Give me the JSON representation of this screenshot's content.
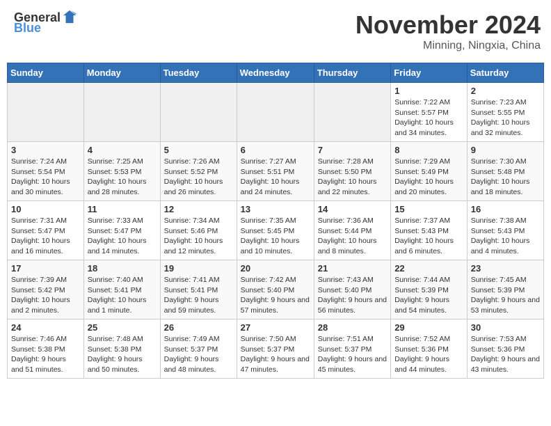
{
  "header": {
    "logo_general": "General",
    "logo_blue": "Blue",
    "month": "November 2024",
    "location": "Minning, Ningxia, China"
  },
  "days_of_week": [
    "Sunday",
    "Monday",
    "Tuesday",
    "Wednesday",
    "Thursday",
    "Friday",
    "Saturday"
  ],
  "weeks": [
    [
      {
        "day": "",
        "info": ""
      },
      {
        "day": "",
        "info": ""
      },
      {
        "day": "",
        "info": ""
      },
      {
        "day": "",
        "info": ""
      },
      {
        "day": "",
        "info": ""
      },
      {
        "day": "1",
        "info": "Sunrise: 7:22 AM\nSunset: 5:57 PM\nDaylight: 10 hours and 34 minutes."
      },
      {
        "day": "2",
        "info": "Sunrise: 7:23 AM\nSunset: 5:55 PM\nDaylight: 10 hours and 32 minutes."
      }
    ],
    [
      {
        "day": "3",
        "info": "Sunrise: 7:24 AM\nSunset: 5:54 PM\nDaylight: 10 hours and 30 minutes."
      },
      {
        "day": "4",
        "info": "Sunrise: 7:25 AM\nSunset: 5:53 PM\nDaylight: 10 hours and 28 minutes."
      },
      {
        "day": "5",
        "info": "Sunrise: 7:26 AM\nSunset: 5:52 PM\nDaylight: 10 hours and 26 minutes."
      },
      {
        "day": "6",
        "info": "Sunrise: 7:27 AM\nSunset: 5:51 PM\nDaylight: 10 hours and 24 minutes."
      },
      {
        "day": "7",
        "info": "Sunrise: 7:28 AM\nSunset: 5:50 PM\nDaylight: 10 hours and 22 minutes."
      },
      {
        "day": "8",
        "info": "Sunrise: 7:29 AM\nSunset: 5:49 PM\nDaylight: 10 hours and 20 minutes."
      },
      {
        "day": "9",
        "info": "Sunrise: 7:30 AM\nSunset: 5:48 PM\nDaylight: 10 hours and 18 minutes."
      }
    ],
    [
      {
        "day": "10",
        "info": "Sunrise: 7:31 AM\nSunset: 5:47 PM\nDaylight: 10 hours and 16 minutes."
      },
      {
        "day": "11",
        "info": "Sunrise: 7:33 AM\nSunset: 5:47 PM\nDaylight: 10 hours and 14 minutes."
      },
      {
        "day": "12",
        "info": "Sunrise: 7:34 AM\nSunset: 5:46 PM\nDaylight: 10 hours and 12 minutes."
      },
      {
        "day": "13",
        "info": "Sunrise: 7:35 AM\nSunset: 5:45 PM\nDaylight: 10 hours and 10 minutes."
      },
      {
        "day": "14",
        "info": "Sunrise: 7:36 AM\nSunset: 5:44 PM\nDaylight: 10 hours and 8 minutes."
      },
      {
        "day": "15",
        "info": "Sunrise: 7:37 AM\nSunset: 5:43 PM\nDaylight: 10 hours and 6 minutes."
      },
      {
        "day": "16",
        "info": "Sunrise: 7:38 AM\nSunset: 5:43 PM\nDaylight: 10 hours and 4 minutes."
      }
    ],
    [
      {
        "day": "17",
        "info": "Sunrise: 7:39 AM\nSunset: 5:42 PM\nDaylight: 10 hours and 2 minutes."
      },
      {
        "day": "18",
        "info": "Sunrise: 7:40 AM\nSunset: 5:41 PM\nDaylight: 10 hours and 1 minute."
      },
      {
        "day": "19",
        "info": "Sunrise: 7:41 AM\nSunset: 5:41 PM\nDaylight: 9 hours and 59 minutes."
      },
      {
        "day": "20",
        "info": "Sunrise: 7:42 AM\nSunset: 5:40 PM\nDaylight: 9 hours and 57 minutes."
      },
      {
        "day": "21",
        "info": "Sunrise: 7:43 AM\nSunset: 5:40 PM\nDaylight: 9 hours and 56 minutes."
      },
      {
        "day": "22",
        "info": "Sunrise: 7:44 AM\nSunset: 5:39 PM\nDaylight: 9 hours and 54 minutes."
      },
      {
        "day": "23",
        "info": "Sunrise: 7:45 AM\nSunset: 5:39 PM\nDaylight: 9 hours and 53 minutes."
      }
    ],
    [
      {
        "day": "24",
        "info": "Sunrise: 7:46 AM\nSunset: 5:38 PM\nDaylight: 9 hours and 51 minutes."
      },
      {
        "day": "25",
        "info": "Sunrise: 7:48 AM\nSunset: 5:38 PM\nDaylight: 9 hours and 50 minutes."
      },
      {
        "day": "26",
        "info": "Sunrise: 7:49 AM\nSunset: 5:37 PM\nDaylight: 9 hours and 48 minutes."
      },
      {
        "day": "27",
        "info": "Sunrise: 7:50 AM\nSunset: 5:37 PM\nDaylight: 9 hours and 47 minutes."
      },
      {
        "day": "28",
        "info": "Sunrise: 7:51 AM\nSunset: 5:37 PM\nDaylight: 9 hours and 45 minutes."
      },
      {
        "day": "29",
        "info": "Sunrise: 7:52 AM\nSunset: 5:36 PM\nDaylight: 9 hours and 44 minutes."
      },
      {
        "day": "30",
        "info": "Sunrise: 7:53 AM\nSunset: 5:36 PM\nDaylight: 9 hours and 43 minutes."
      }
    ]
  ]
}
